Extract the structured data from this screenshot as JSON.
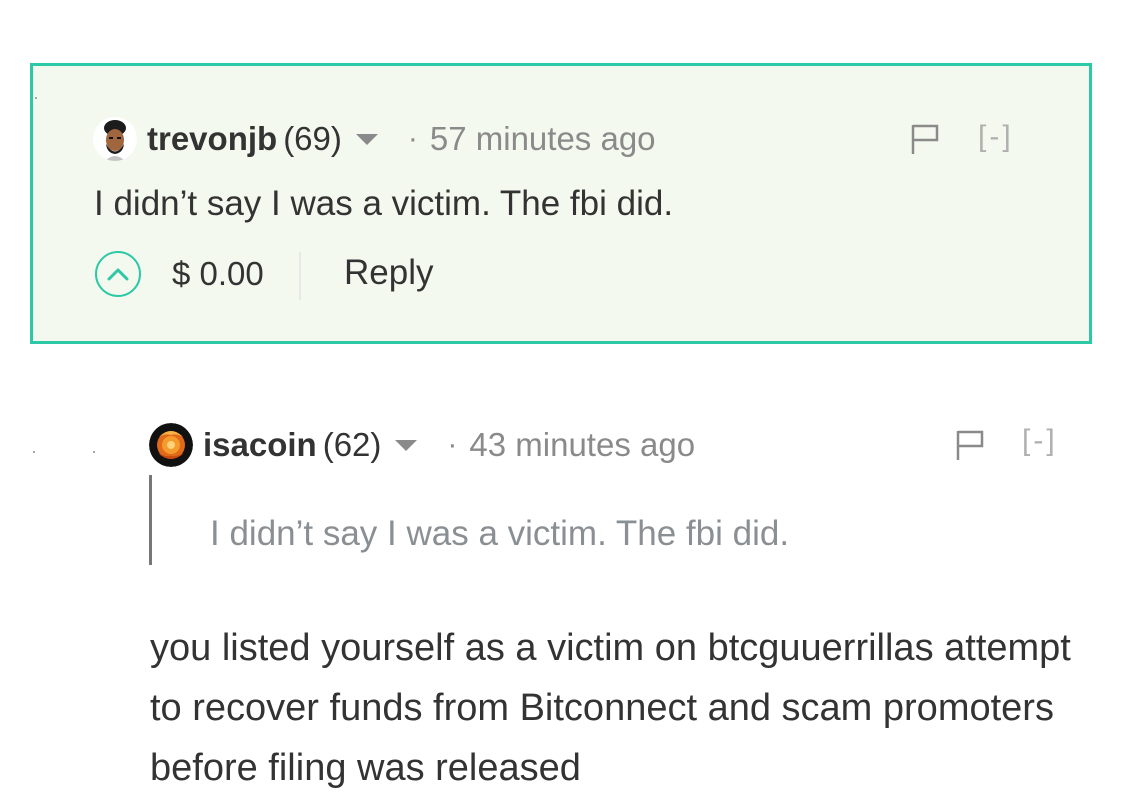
{
  "comments": [
    {
      "username": "trevonjb",
      "reputation": "(69)",
      "separator": "·",
      "timestamp": "57 minutes ago",
      "body": "I didn’t say I was a victim. The fbi did.",
      "payout": "$ 0.00",
      "reply_label": "Reply",
      "collapse_label": "[-]"
    },
    {
      "username": "isacoin",
      "reputation": "(62)",
      "separator": "·",
      "timestamp": "43 minutes ago",
      "quote": "I didn’t say I was a victim. The fbi did.",
      "paragraph": "you listed yourself as a victim on btcguuerrillas attempt to recover funds from Bitconnect and scam promoters before filing was released",
      "collapse_label": "[-]"
    }
  ],
  "colors": {
    "highlight_border": "#2dc8a5",
    "highlight_bg": "#f3f9ef",
    "muted_text": "#8a8a8a"
  },
  "icons": [
    "avatar",
    "caret-down-icon",
    "flag-icon",
    "upvote-chevron-icon"
  ]
}
